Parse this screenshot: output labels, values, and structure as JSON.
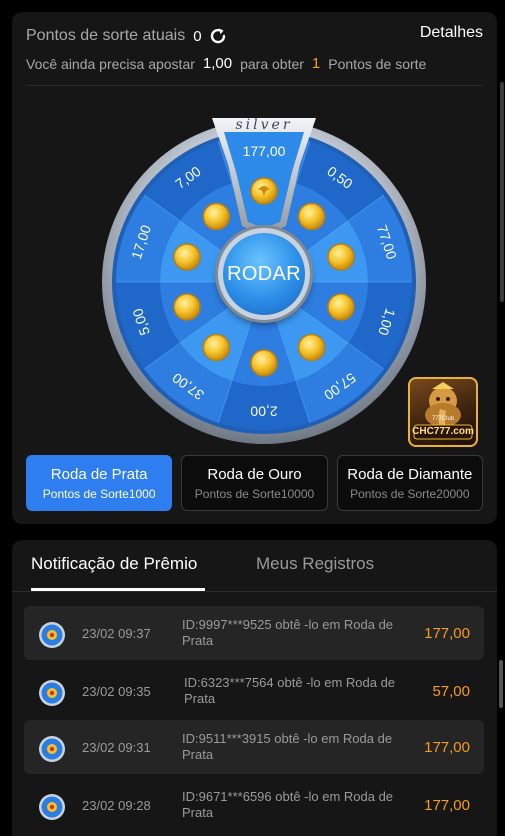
{
  "header": {
    "luck_label": "Pontos de sorte atuais",
    "luck_value": "0",
    "details_label": "Detalhes",
    "need_prefix": "Você ainda precisa apostar",
    "need_amount": "1,00",
    "need_middle": "para obter",
    "need_points": "1",
    "need_suffix": "Pontos de sorte"
  },
  "wheel": {
    "tier_label": "silver",
    "spin_label": "RODAR",
    "segments": [
      "177,00",
      "0,50",
      "77,00",
      "1,00",
      "57,00",
      "2,00",
      "37,00",
      "5,00",
      "17,00",
      "7,00"
    ],
    "colors": {
      "outer": "#2e7de0",
      "inner": "#3c98f0",
      "dark": "#1f67c9",
      "highlight": "#e9f3ff",
      "coin": "#f6c22a"
    }
  },
  "tiers": [
    {
      "name": "Roda de Prata",
      "points": "Pontos de Sorte1000",
      "active": true
    },
    {
      "name": "Roda de Ouro",
      "points": "Pontos de Sorte10000",
      "active": false
    },
    {
      "name": "Roda de Diamante",
      "points": "Pontos de Sorte20000",
      "active": false
    }
  ],
  "logo": {
    "text": "CHC777.com",
    "subtext": "777Club"
  },
  "tabs": {
    "notify": "Notificação de Prêmio",
    "records": "Meus Registros"
  },
  "notifications": [
    {
      "time": "23/02 09:37",
      "desc": "ID:9997***9525 obtê -lo em Roda de Prata",
      "amount": "177,00"
    },
    {
      "time": "23/02 09:35",
      "desc": "ID:6323***7564 obtê -lo em Roda de Prata",
      "amount": "57,00"
    },
    {
      "time": "23/02 09:31",
      "desc": "ID:9511***3915 obtê -lo em Roda de Prata",
      "amount": "177,00"
    },
    {
      "time": "23/02 09:28",
      "desc": "ID:9671***6596 obtê -lo em Roda de Prata",
      "amount": "177,00"
    }
  ]
}
